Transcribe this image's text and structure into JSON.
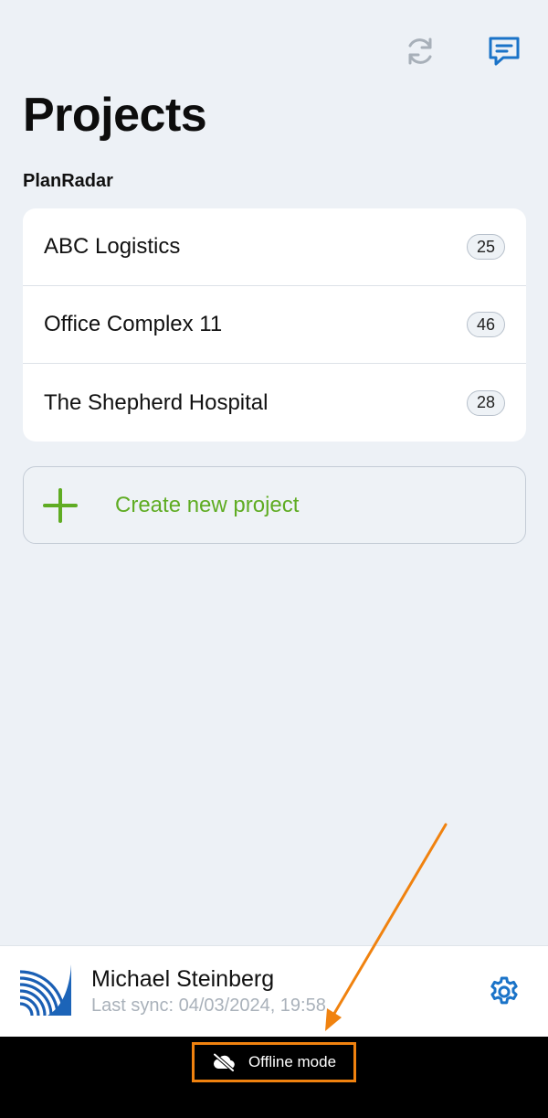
{
  "header": {
    "sync_icon": "sync-arrows-icon",
    "chat_icon": "chat-message-icon",
    "title": "Projects",
    "org_name": "PlanRadar"
  },
  "projects": [
    {
      "name": "ABC Logistics",
      "count": "25"
    },
    {
      "name": "Office Complex 11",
      "count": "46"
    },
    {
      "name": "The Shepherd Hospital",
      "count": "28"
    }
  ],
  "create_project": {
    "icon": "plus-icon",
    "label": "Create new project"
  },
  "user": {
    "name": "Michael Steinberg",
    "last_sync": "Last sync: 04/03/2024, 19:58",
    "avatar_icon": "planradar-logo",
    "settings_icon": "gear-icon"
  },
  "status": {
    "offline_icon": "cloud-off-icon",
    "offline_label": "Offline mode"
  },
  "colors": {
    "accent_blue": "#1a73c8",
    "accent_green": "#5fac23",
    "highlight_orange": "#f0820f",
    "background": "#edf1f6"
  }
}
